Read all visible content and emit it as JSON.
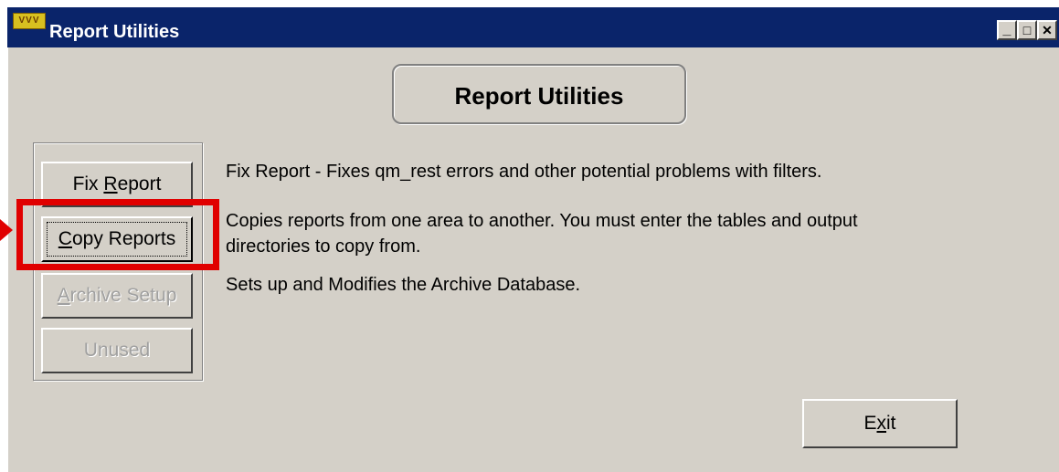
{
  "window": {
    "title": "Report Utilities",
    "app_icon_text": "VVV",
    "controls": {
      "minimize": "_",
      "maximize": "□",
      "close": "✕"
    }
  },
  "header": {
    "title": "Report Utilities"
  },
  "buttons": [
    {
      "pre": "Fix ",
      "key": "R",
      "post": "eport",
      "disabled": false
    },
    {
      "pre": "",
      "key": "C",
      "post": "opy Reports",
      "disabled": false
    },
    {
      "pre": "",
      "key": "A",
      "post": "rchive Setup",
      "disabled": true
    },
    {
      "pre": "",
      "key": "",
      "post": "Unused",
      "disabled": true
    }
  ],
  "descriptions": {
    "fix_report": "Fix Report - Fixes qm_rest errors and other potential problems with filters.",
    "copy_reports_line1": "Copies reports from one area to another. You must enter the tables and output",
    "copy_reports_line2": "directories to copy from.",
    "archive_setup": "Sets up and Modifies the Archive Database."
  },
  "exit_button": {
    "pre": "E",
    "key": "x",
    "post": "it"
  },
  "annotation": {
    "color": "#e00000",
    "highlight_target": "copy-reports-button"
  }
}
